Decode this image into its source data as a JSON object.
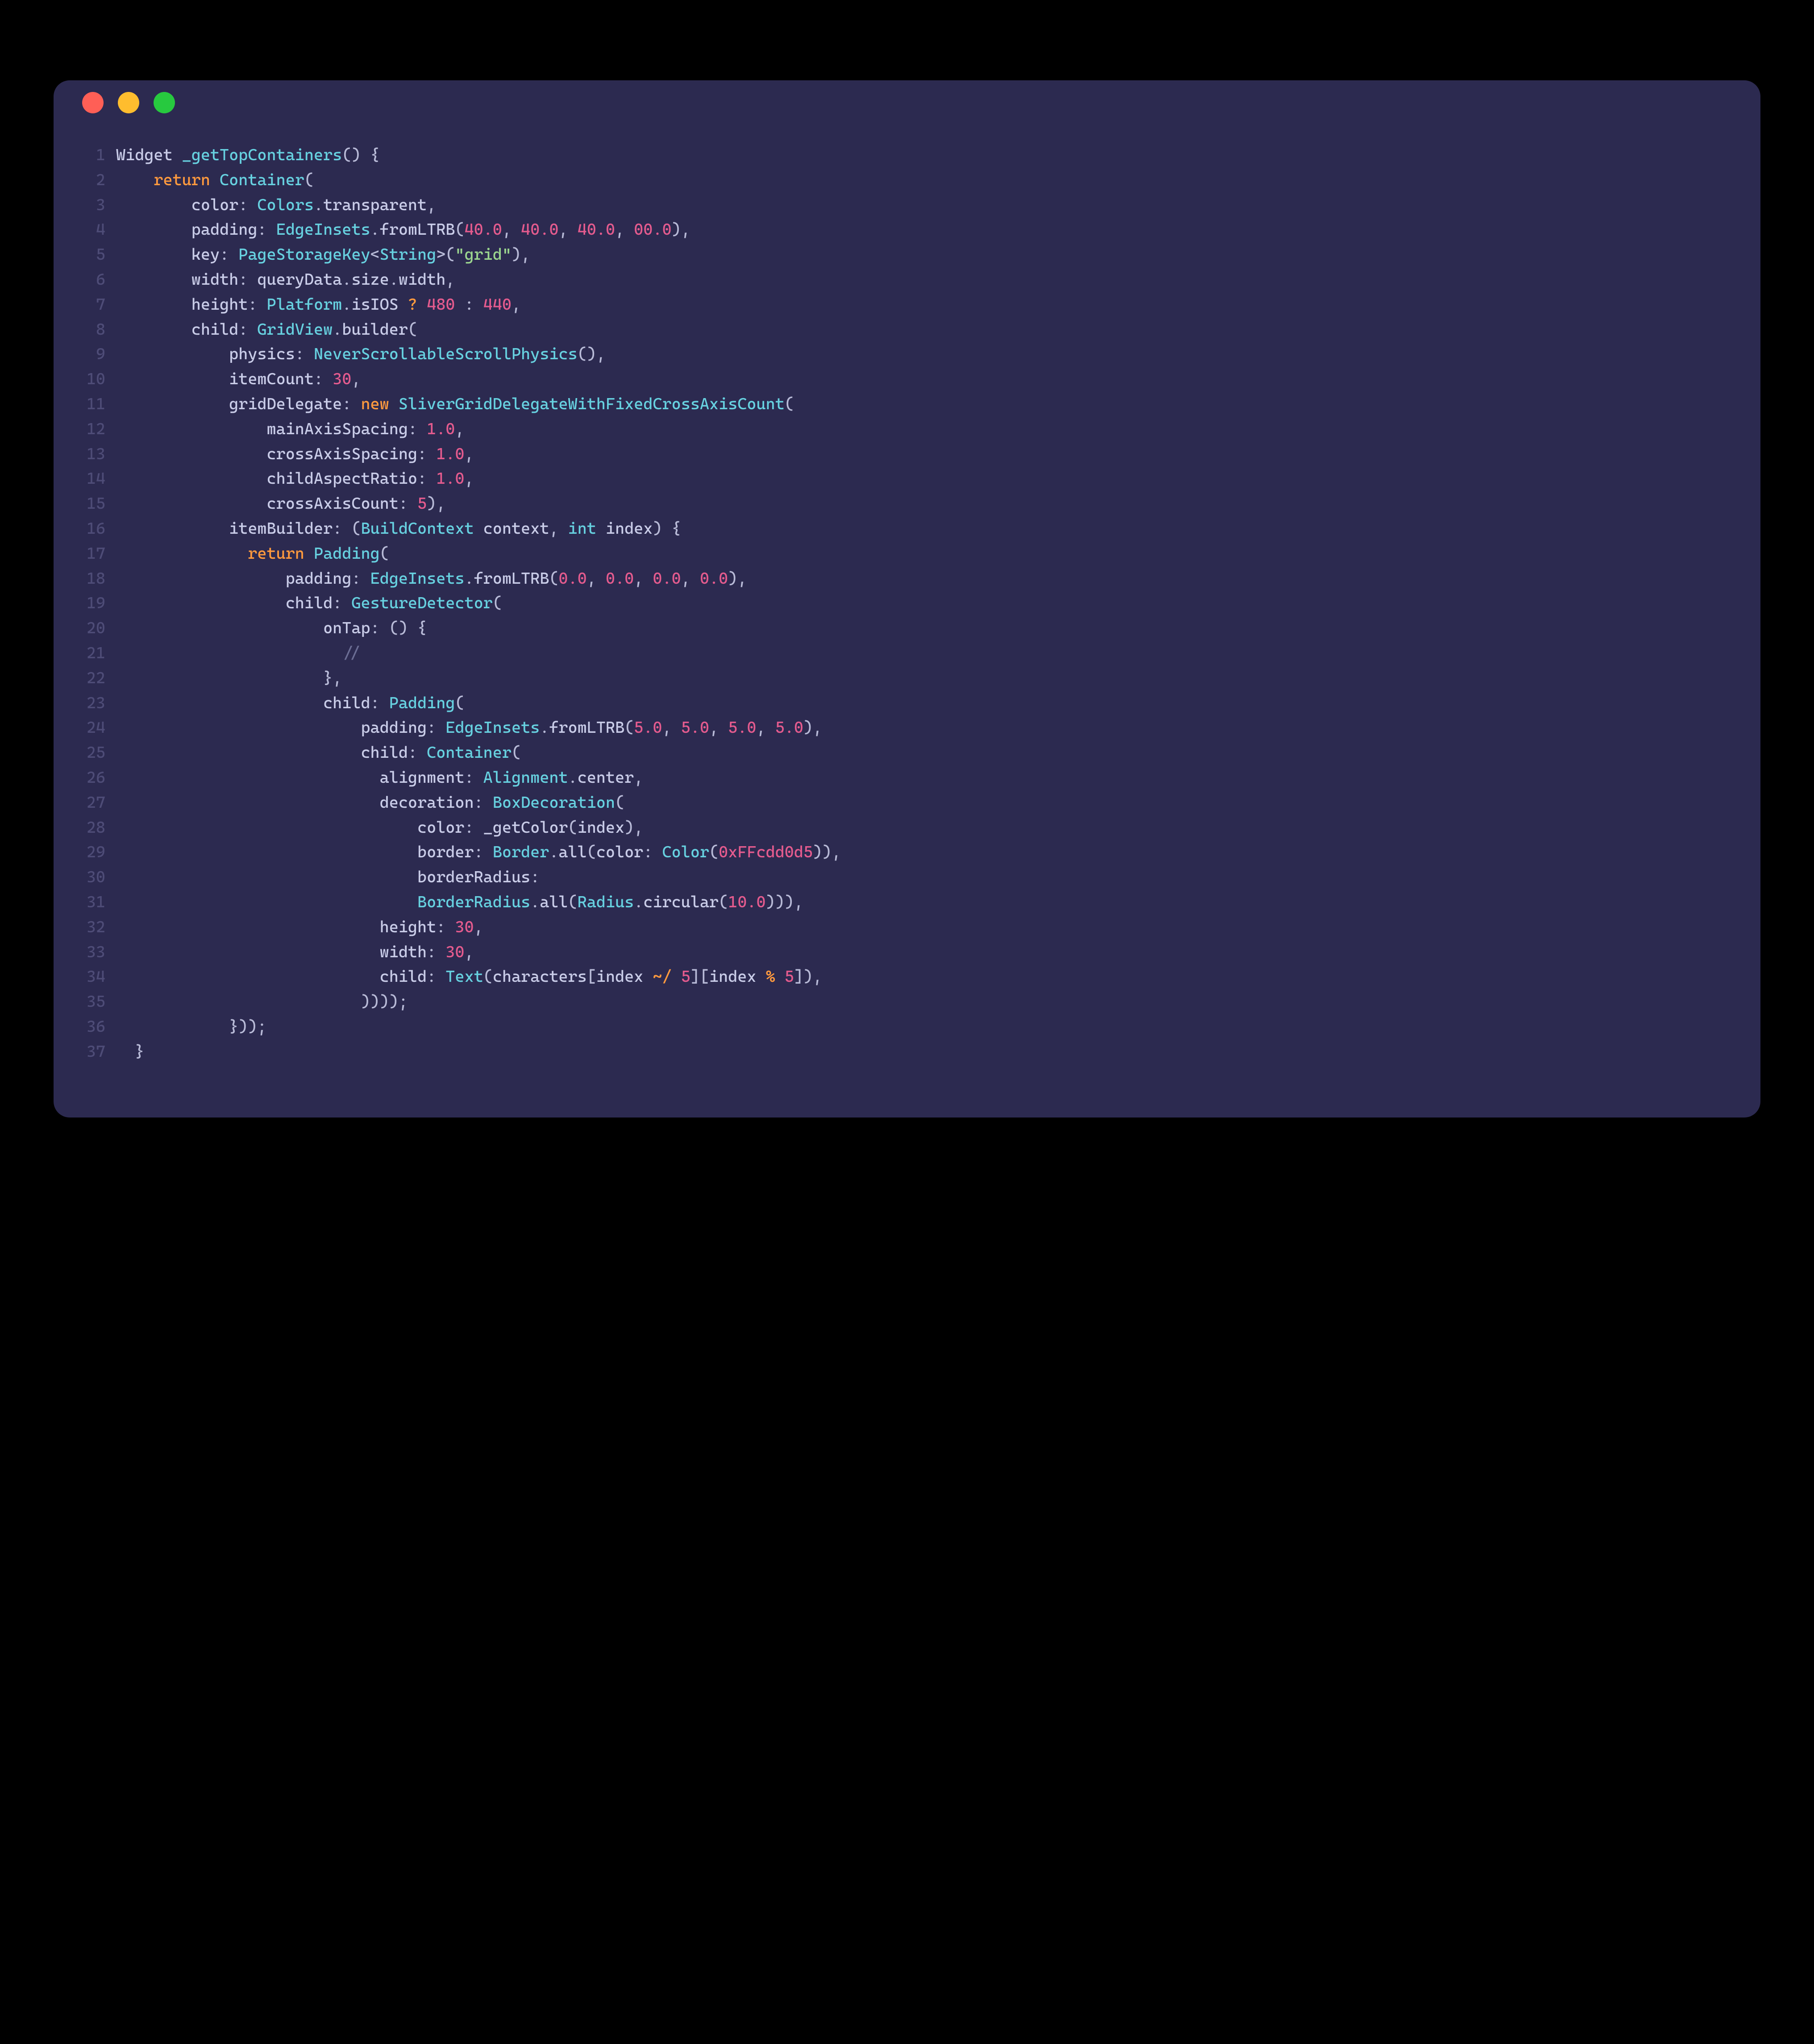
{
  "window": {
    "dots": {
      "close": "#ff5f56",
      "minimize": "#ffbd2e",
      "maximize": "#27c93f"
    }
  },
  "code": {
    "language": "dart",
    "lines": [
      {
        "n": 1,
        "t": [
          [
            "default",
            "Widget "
          ],
          [
            "type",
            "_getTopContainers"
          ],
          [
            "punct",
            "() {"
          ]
        ]
      },
      {
        "n": 2,
        "t": [
          [
            "default",
            "    "
          ],
          [
            "keyword",
            "return"
          ],
          [
            "default",
            " "
          ],
          [
            "type",
            "Container"
          ],
          [
            "punct",
            "("
          ]
        ]
      },
      {
        "n": 3,
        "t": [
          [
            "default",
            "        "
          ],
          [
            "prop",
            "color"
          ],
          [
            "punct",
            ": "
          ],
          [
            "type",
            "Colors"
          ],
          [
            "punct",
            "."
          ],
          [
            "default",
            "transparent"
          ],
          [
            "punct",
            ","
          ]
        ]
      },
      {
        "n": 4,
        "t": [
          [
            "default",
            "        "
          ],
          [
            "prop",
            "padding"
          ],
          [
            "punct",
            ": "
          ],
          [
            "type",
            "EdgeInsets"
          ],
          [
            "punct",
            "."
          ],
          [
            "default",
            "fromLTRB"
          ],
          [
            "punct",
            "("
          ],
          [
            "number",
            "40.0"
          ],
          [
            "punct",
            ", "
          ],
          [
            "number",
            "40.0"
          ],
          [
            "punct",
            ", "
          ],
          [
            "number",
            "40.0"
          ],
          [
            "punct",
            ", "
          ],
          [
            "number",
            "00.0"
          ],
          [
            "punct",
            "),"
          ]
        ]
      },
      {
        "n": 5,
        "t": [
          [
            "default",
            "        "
          ],
          [
            "prop",
            "key"
          ],
          [
            "punct",
            ": "
          ],
          [
            "type",
            "PageStorageKey"
          ],
          [
            "punct",
            "<"
          ],
          [
            "type",
            "String"
          ],
          [
            "punct",
            ">("
          ],
          [
            "string",
            "\"grid\""
          ],
          [
            "punct",
            "),"
          ]
        ]
      },
      {
        "n": 6,
        "t": [
          [
            "default",
            "        "
          ],
          [
            "prop",
            "width"
          ],
          [
            "punct",
            ": "
          ],
          [
            "default",
            "queryData"
          ],
          [
            "punct",
            "."
          ],
          [
            "default",
            "size"
          ],
          [
            "punct",
            "."
          ],
          [
            "default",
            "width"
          ],
          [
            "punct",
            ","
          ]
        ]
      },
      {
        "n": 7,
        "t": [
          [
            "default",
            "        "
          ],
          [
            "prop",
            "height"
          ],
          [
            "punct",
            ": "
          ],
          [
            "type",
            "Platform"
          ],
          [
            "punct",
            "."
          ],
          [
            "default",
            "isIOS "
          ],
          [
            "keyword",
            "?"
          ],
          [
            "default",
            " "
          ],
          [
            "number",
            "480"
          ],
          [
            "default",
            " "
          ],
          [
            "punct",
            ":"
          ],
          [
            "default",
            " "
          ],
          [
            "number",
            "440"
          ],
          [
            "punct",
            ","
          ]
        ]
      },
      {
        "n": 8,
        "t": [
          [
            "default",
            "        "
          ],
          [
            "prop",
            "child"
          ],
          [
            "punct",
            ": "
          ],
          [
            "type",
            "GridView"
          ],
          [
            "punct",
            "."
          ],
          [
            "default",
            "builder"
          ],
          [
            "punct",
            "("
          ]
        ]
      },
      {
        "n": 9,
        "t": [
          [
            "default",
            "            "
          ],
          [
            "prop",
            "physics"
          ],
          [
            "punct",
            ": "
          ],
          [
            "type",
            "NeverScrollableScrollPhysics"
          ],
          [
            "punct",
            "(),"
          ]
        ]
      },
      {
        "n": 10,
        "t": [
          [
            "default",
            "            "
          ],
          [
            "prop",
            "itemCount"
          ],
          [
            "punct",
            ": "
          ],
          [
            "number",
            "30"
          ],
          [
            "punct",
            ","
          ]
        ]
      },
      {
        "n": 11,
        "t": [
          [
            "default",
            "            "
          ],
          [
            "prop",
            "gridDelegate"
          ],
          [
            "punct",
            ": "
          ],
          [
            "keyword",
            "new"
          ],
          [
            "default",
            " "
          ],
          [
            "type",
            "SliverGridDelegateWithFixedCrossAxisCount"
          ],
          [
            "punct",
            "("
          ]
        ]
      },
      {
        "n": 12,
        "t": [
          [
            "default",
            "                "
          ],
          [
            "prop",
            "mainAxisSpacing"
          ],
          [
            "punct",
            ": "
          ],
          [
            "number",
            "1.0"
          ],
          [
            "punct",
            ","
          ]
        ]
      },
      {
        "n": 13,
        "t": [
          [
            "default",
            "                "
          ],
          [
            "prop",
            "crossAxisSpacing"
          ],
          [
            "punct",
            ": "
          ],
          [
            "number",
            "1.0"
          ],
          [
            "punct",
            ","
          ]
        ]
      },
      {
        "n": 14,
        "t": [
          [
            "default",
            "                "
          ],
          [
            "prop",
            "childAspectRatio"
          ],
          [
            "punct",
            ": "
          ],
          [
            "number",
            "1.0"
          ],
          [
            "punct",
            ","
          ]
        ]
      },
      {
        "n": 15,
        "t": [
          [
            "default",
            "                "
          ],
          [
            "prop",
            "crossAxisCount"
          ],
          [
            "punct",
            ": "
          ],
          [
            "number",
            "5"
          ],
          [
            "punct",
            "),"
          ]
        ]
      },
      {
        "n": 16,
        "t": [
          [
            "default",
            "            "
          ],
          [
            "prop",
            "itemBuilder"
          ],
          [
            "punct",
            ": ("
          ],
          [
            "type",
            "BuildContext"
          ],
          [
            "default",
            " context"
          ],
          [
            "punct",
            ", "
          ],
          [
            "type",
            "int"
          ],
          [
            "default",
            " index"
          ],
          [
            "punct",
            ") {"
          ]
        ]
      },
      {
        "n": 17,
        "t": [
          [
            "default",
            "              "
          ],
          [
            "keyword",
            "return"
          ],
          [
            "default",
            " "
          ],
          [
            "type",
            "Padding"
          ],
          [
            "punct",
            "("
          ]
        ]
      },
      {
        "n": 18,
        "t": [
          [
            "default",
            "                  "
          ],
          [
            "prop",
            "padding"
          ],
          [
            "punct",
            ": "
          ],
          [
            "type",
            "EdgeInsets"
          ],
          [
            "punct",
            "."
          ],
          [
            "default",
            "fromLTRB"
          ],
          [
            "punct",
            "("
          ],
          [
            "number",
            "0.0"
          ],
          [
            "punct",
            ", "
          ],
          [
            "number",
            "0.0"
          ],
          [
            "punct",
            ", "
          ],
          [
            "number",
            "0.0"
          ],
          [
            "punct",
            ", "
          ],
          [
            "number",
            "0.0"
          ],
          [
            "punct",
            "),"
          ]
        ]
      },
      {
        "n": 19,
        "t": [
          [
            "default",
            "                  "
          ],
          [
            "prop",
            "child"
          ],
          [
            "punct",
            ": "
          ],
          [
            "type",
            "GestureDetector"
          ],
          [
            "punct",
            "("
          ]
        ]
      },
      {
        "n": 20,
        "t": [
          [
            "default",
            "                      "
          ],
          [
            "prop",
            "onTap"
          ],
          [
            "punct",
            ": () {"
          ]
        ]
      },
      {
        "n": 21,
        "t": [
          [
            "default",
            "                        "
          ],
          [
            "comment",
            "//"
          ]
        ]
      },
      {
        "n": 22,
        "t": [
          [
            "default",
            "                      "
          ],
          [
            "punct",
            "},"
          ]
        ]
      },
      {
        "n": 23,
        "t": [
          [
            "default",
            "                      "
          ],
          [
            "prop",
            "child"
          ],
          [
            "punct",
            ": "
          ],
          [
            "type",
            "Padding"
          ],
          [
            "punct",
            "("
          ]
        ]
      },
      {
        "n": 24,
        "t": [
          [
            "default",
            "                          "
          ],
          [
            "prop",
            "padding"
          ],
          [
            "punct",
            ": "
          ],
          [
            "type",
            "EdgeInsets"
          ],
          [
            "punct",
            "."
          ],
          [
            "default",
            "fromLTRB"
          ],
          [
            "punct",
            "("
          ],
          [
            "number",
            "5.0"
          ],
          [
            "punct",
            ", "
          ],
          [
            "number",
            "5.0"
          ],
          [
            "punct",
            ", "
          ],
          [
            "number",
            "5.0"
          ],
          [
            "punct",
            ", "
          ],
          [
            "number",
            "5.0"
          ],
          [
            "punct",
            "),"
          ]
        ]
      },
      {
        "n": 25,
        "t": [
          [
            "default",
            "                          "
          ],
          [
            "prop",
            "child"
          ],
          [
            "punct",
            ": "
          ],
          [
            "type",
            "Container"
          ],
          [
            "punct",
            "("
          ]
        ]
      },
      {
        "n": 26,
        "t": [
          [
            "default",
            "                            "
          ],
          [
            "prop",
            "alignment"
          ],
          [
            "punct",
            ": "
          ],
          [
            "type",
            "Alignment"
          ],
          [
            "punct",
            "."
          ],
          [
            "default",
            "center"
          ],
          [
            "punct",
            ","
          ]
        ]
      },
      {
        "n": 27,
        "t": [
          [
            "default",
            "                            "
          ],
          [
            "prop",
            "decoration"
          ],
          [
            "punct",
            ": "
          ],
          [
            "type",
            "BoxDecoration"
          ],
          [
            "punct",
            "("
          ]
        ]
      },
      {
        "n": 28,
        "t": [
          [
            "default",
            "                                "
          ],
          [
            "prop",
            "color"
          ],
          [
            "punct",
            ": "
          ],
          [
            "default",
            "_getColor"
          ],
          [
            "punct",
            "("
          ],
          [
            "default",
            "index"
          ],
          [
            "punct",
            "),"
          ]
        ]
      },
      {
        "n": 29,
        "t": [
          [
            "default",
            "                                "
          ],
          [
            "prop",
            "border"
          ],
          [
            "punct",
            ": "
          ],
          [
            "type",
            "Border"
          ],
          [
            "punct",
            "."
          ],
          [
            "default",
            "all"
          ],
          [
            "punct",
            "("
          ],
          [
            "prop",
            "color"
          ],
          [
            "punct",
            ": "
          ],
          [
            "type",
            "Color"
          ],
          [
            "punct",
            "("
          ],
          [
            "number",
            "0xFFcdd0d5"
          ],
          [
            "punct",
            ")),"
          ]
        ]
      },
      {
        "n": 30,
        "t": [
          [
            "default",
            "                                "
          ],
          [
            "prop",
            "borderRadius"
          ],
          [
            "punct",
            ":"
          ]
        ]
      },
      {
        "n": 31,
        "t": [
          [
            "default",
            "                                "
          ],
          [
            "type",
            "BorderRadius"
          ],
          [
            "punct",
            "."
          ],
          [
            "default",
            "all"
          ],
          [
            "punct",
            "("
          ],
          [
            "type",
            "Radius"
          ],
          [
            "punct",
            "."
          ],
          [
            "default",
            "circular"
          ],
          [
            "punct",
            "("
          ],
          [
            "number",
            "10.0"
          ],
          [
            "punct",
            "))),"
          ]
        ]
      },
      {
        "n": 32,
        "t": [
          [
            "default",
            "                            "
          ],
          [
            "prop",
            "height"
          ],
          [
            "punct",
            ": "
          ],
          [
            "number",
            "30"
          ],
          [
            "punct",
            ","
          ]
        ]
      },
      {
        "n": 33,
        "t": [
          [
            "default",
            "                            "
          ],
          [
            "prop",
            "width"
          ],
          [
            "punct",
            ": "
          ],
          [
            "number",
            "30"
          ],
          [
            "punct",
            ","
          ]
        ]
      },
      {
        "n": 34,
        "t": [
          [
            "default",
            "                            "
          ],
          [
            "prop",
            "child"
          ],
          [
            "punct",
            ": "
          ],
          [
            "type",
            "Text"
          ],
          [
            "punct",
            "("
          ],
          [
            "default",
            "characters"
          ],
          [
            "punct",
            "["
          ],
          [
            "default",
            "index "
          ],
          [
            "keyword",
            "~/"
          ],
          [
            "default",
            " "
          ],
          [
            "number",
            "5"
          ],
          [
            "punct",
            "]["
          ],
          [
            "default",
            "index "
          ],
          [
            "keyword",
            "%"
          ],
          [
            "default",
            " "
          ],
          [
            "number",
            "5"
          ],
          [
            "punct",
            "]),"
          ]
        ]
      },
      {
        "n": 35,
        "t": [
          [
            "default",
            "                          "
          ],
          [
            "punct",
            "))));"
          ]
        ]
      },
      {
        "n": 36,
        "t": [
          [
            "default",
            "            "
          ],
          [
            "punct",
            "}));"
          ]
        ]
      },
      {
        "n": 37,
        "t": [
          [
            "default",
            "  "
          ],
          [
            "punct",
            "}"
          ]
        ]
      }
    ]
  }
}
